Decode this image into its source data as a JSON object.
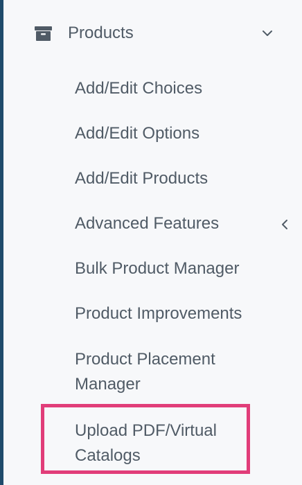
{
  "nav": {
    "group": {
      "label": "Products",
      "icon": "archive-icon",
      "expanded": true
    },
    "items": [
      {
        "label": "Add/Edit Choices"
      },
      {
        "label": "Add/Edit Options"
      },
      {
        "label": "Add/Edit Products"
      },
      {
        "label": "Advanced Features",
        "has_submenu": true,
        "submenu_icon": "chevron-left-icon"
      },
      {
        "label": "Bulk Product Manager"
      },
      {
        "label": "Product Improvements"
      },
      {
        "label": "Product Placement Manager",
        "lines": [
          "Product Placement",
          "Manager"
        ]
      },
      {
        "label": "Upload PDF/Virtual Catalogs",
        "lines": [
          "Upload PDF/Virtual",
          "Catalogs"
        ],
        "highlighted": true
      }
    ]
  },
  "colors": {
    "background": "#f7f8fa",
    "rail": "#1f4b6b",
    "text": "#505b66",
    "highlight": "#e13d79"
  }
}
